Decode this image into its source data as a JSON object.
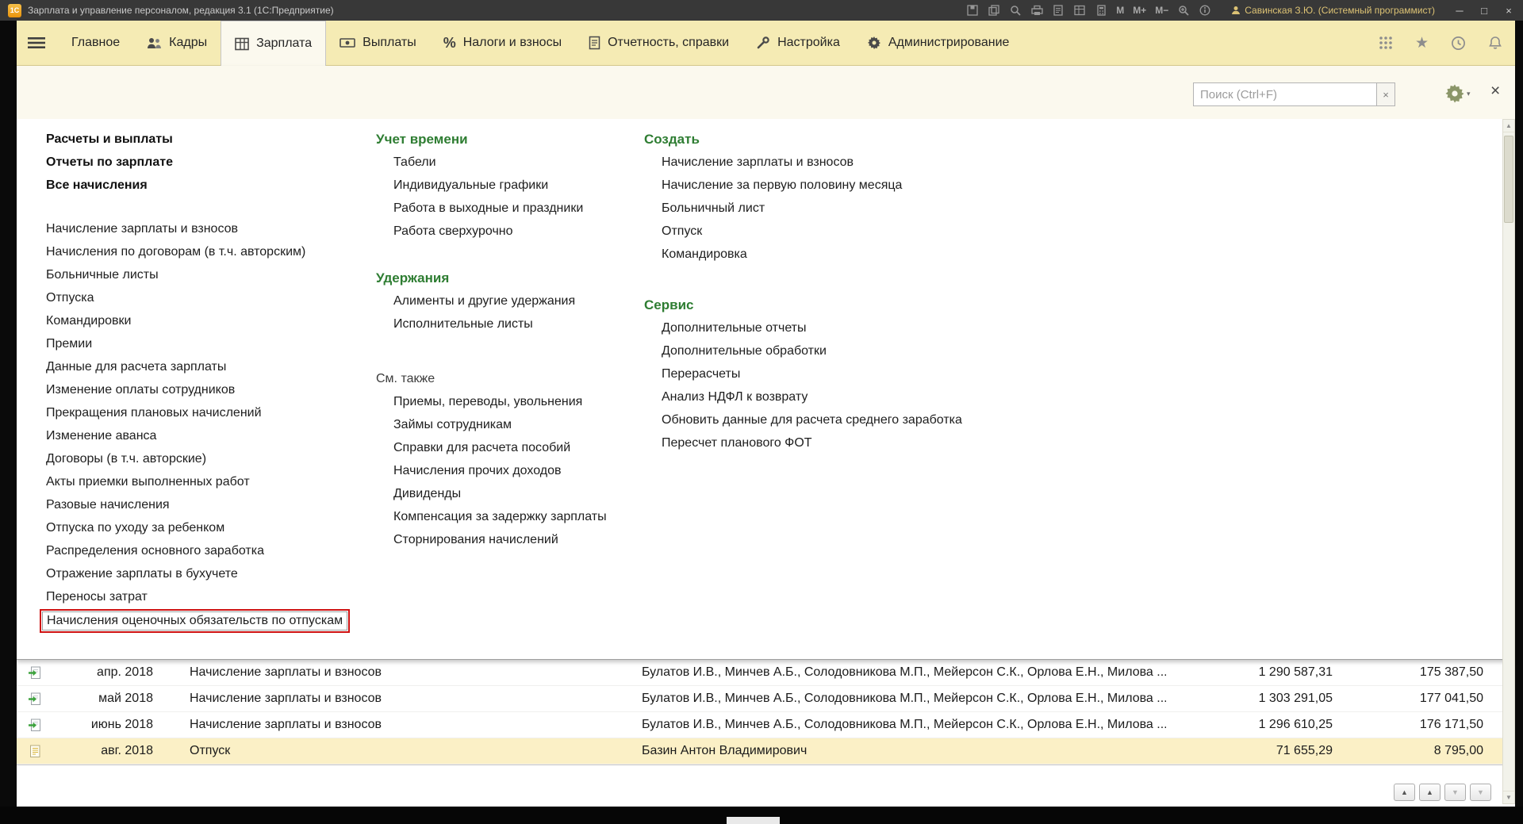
{
  "titlebar": {
    "logo_text": "1С",
    "title": "Зарплата и управление персоналом, редакция 3.1  (1С:Предприятие)",
    "memory_buttons": [
      "М",
      "М+",
      "М−"
    ],
    "user": "Савинская З.Ю. (Системный программист)"
  },
  "glyphs": {
    "minimize": "─",
    "maximize": "□",
    "close": "×",
    "clear": "×",
    "panel_close": "×",
    "caret_down": "▾",
    "star": "★",
    "percent": "%",
    "nav_up": "▲",
    "nav_down": "▼",
    "scroll_up": "▲",
    "scroll_down": "▼"
  },
  "colors": {
    "menubar_yellow": "#f5ebb4",
    "section_green": "#2e7d32",
    "highlight_red": "#cf1212",
    "selected_row_yellow": "#fbf0c6"
  },
  "menubar": {
    "items": [
      "Главное",
      "Кадры",
      "Зарплата",
      "Выплаты",
      "Налоги и взносы",
      "Отчетность, справки",
      "Настройка",
      "Администрирование"
    ],
    "active_item": "Зарплата"
  },
  "function_menu": {
    "search_placeholder": "Поиск (Ctrl+F)",
    "col1_top": [
      "Расчеты и выплаты",
      "Отчеты по зарплате",
      "Все начисления"
    ],
    "col1_items": [
      "Начисление зарплаты и взносов",
      "Начисления по договорам (в т.ч. авторским)",
      "Больничные листы",
      "Отпуска",
      "Командировки",
      "Премии",
      "Данные для расчета зарплаты",
      "Изменение оплаты сотрудников",
      "Прекращения плановых начислений",
      "Изменение аванса",
      "Договоры (в т.ч. авторские)",
      "Акты приемки выполненных работ",
      "Разовые начисления",
      "Отпуска по уходу за ребенком",
      "Распределения основного заработка",
      "Отражение зарплаты в бухучете",
      "Переносы затрат",
      "Начисления оценочных обязательств по отпускам"
    ],
    "highlighted_item": "Начисления оценочных обязательств по отпускам",
    "col2_sections": [
      {
        "title": "Учет времени",
        "items": [
          "Табели",
          "Индивидуальные графики",
          "Работа в выходные и праздники",
          "Работа сверхурочно"
        ]
      },
      {
        "title": "Удержания",
        "items": [
          "Алименты и другие удержания",
          "Исполнительные листы"
        ]
      },
      {
        "title": "См. также",
        "items": [
          "Приемы, переводы, увольнения",
          "Займы сотрудникам",
          "Справки для расчета пособий",
          "Начисления прочих доходов",
          "Дивиденды",
          "Компенсация за задержку зарплаты",
          "Сторнирования начислений"
        ]
      }
    ],
    "col3_sections": [
      {
        "title": "Создать",
        "items": [
          "Начисление зарплаты и взносов",
          "Начисление за первую половину месяца",
          "Больничный лист",
          "Отпуск",
          "Командировка"
        ]
      },
      {
        "title": "Сервис",
        "items": [
          "Дополнительные отчеты",
          "Дополнительные обработки",
          "Перерасчеты",
          "Анализ НДФЛ к возврату",
          "Обновить данные для расчета среднего заработка",
          "Пересчет планового ФОТ"
        ]
      }
    ]
  },
  "document_list": {
    "rows": [
      {
        "month": "апр. 2018",
        "type": "Начисление зарплаты и взносов",
        "employees": "Булатов И.В., Минчев А.Б., Солодовникова М.П., Мейерсон С.К., Орлова Е.Н., Милова ...",
        "amount": "1 290 587,31",
        "tax": "175 387,50",
        "icon": "posted-document"
      },
      {
        "month": "май 2018",
        "type": "Начисление зарплаты и взносов",
        "employees": "Булатов И.В., Минчев А.Б., Солодовникова М.П., Мейерсон С.К., Орлова Е.Н., Милова ...",
        "amount": "1 303 291,05",
        "tax": "177 041,50",
        "icon": "posted-document"
      },
      {
        "month": "июнь 2018",
        "type": "Начисление зарплаты и взносов",
        "employees": "Булатов И.В., Минчев А.Б., Солодовникова М.П., Мейерсон С.К., Орлова Е.Н., Милова ...",
        "amount": "1 296 610,25",
        "tax": "176 171,50",
        "icon": "posted-document"
      },
      {
        "month": "авг. 2018",
        "type": "Отпуск",
        "employees": "Базин Антон Владимирович",
        "amount": "71 655,29",
        "tax": "8 795,00",
        "icon": "vacation-document",
        "selected": true
      }
    ]
  }
}
